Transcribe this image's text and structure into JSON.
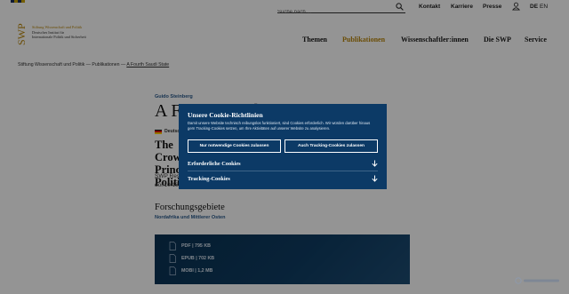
{
  "topbar": {
    "search_placeholder": "Suche nach ...",
    "links": [
      "Kontakt",
      "Karriere",
      "Presse"
    ],
    "lang_de": "DE",
    "lang_en": "EN"
  },
  "logo": {
    "swp": "SWP",
    "line1": "Stiftung Wissenschaft und Politik",
    "line2": "Deutsches Institut für",
    "line3": "Internationale Politik und Sicherheit"
  },
  "mainnav": {
    "items": [
      "Themen",
      "Publikationen",
      "Wissenschaftler:innen",
      "Die SWP",
      "Service"
    ],
    "active": "Publikationen"
  },
  "breadcrumb": {
    "items": [
      "Stiftung Wissenschaft und Politik",
      "Publikationen",
      "A Fourth Saudi State"
    ],
    "separator": "—"
  },
  "article": {
    "author": "Guido Steinberg",
    "title": "A Fourth Saudi State",
    "language_label": "Deutsch",
    "subtitle": "The Crown Prince's Politics",
    "meta1": "SWP Research Paper",
    "meta2": "doi:10.18449"
  },
  "forschung": {
    "title": "Forschungsgebiete",
    "link": "Nordafrika und Mittlerer Osten"
  },
  "downloads": [
    {
      "label": "PDF | 795 KB",
      "icon": "pdf-icon"
    },
    {
      "label": "EPUB | 702 KB",
      "icon": "epub-icon"
    },
    {
      "label": "MOBI | 1,2 MB",
      "icon": "mobi-icon"
    }
  ],
  "cookie": {
    "title": "Unsere Cookie-Richtlinien",
    "text": "Damit unsere Website technisch reibungslos funktioniert, sind Cookies erforderlich. Wir würden darüber hinaus gern Tracking-Cookies setzen, um Ihre Aktivitäten auf unserer Website zu analysieren.",
    "btn_necessary": "Nur notwendige Cookies zulassen",
    "btn_tracking": "Auch Tracking-Cookies zulassen",
    "section1": "Erforderliche Cookies",
    "section2": "Tracking-Cookies"
  },
  "colors": {
    "accent_gold": "#b8860b",
    "link_blue": "#2a5a8c",
    "cookie_bg": "#0c3a66",
    "download_bg": "#0e3c62"
  }
}
